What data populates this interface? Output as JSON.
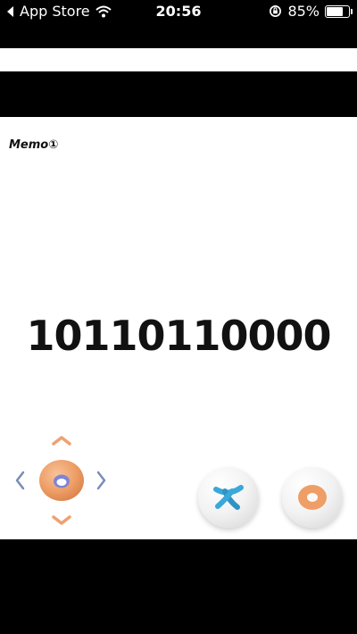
{
  "status_bar": {
    "back_app": "App Store",
    "time": "20:56",
    "battery": "85%",
    "battery_level": 0.85
  },
  "game": {
    "memo_label": "Memo①",
    "display_value": "10110110000"
  },
  "controls": {
    "icons": {
      "up": "chevron-up-icon",
      "down": "chevron-down-icon",
      "left": "chevron-left-icon",
      "right": "chevron-right-icon",
      "center": "donut-icon",
      "cancel": "cross-icon",
      "confirm": "ring-icon"
    }
  },
  "colors": {
    "accent_orange": "#F0A070",
    "accent_blue": "#3AA8D8",
    "arrow_gray_blue": "#7A8CB8"
  }
}
